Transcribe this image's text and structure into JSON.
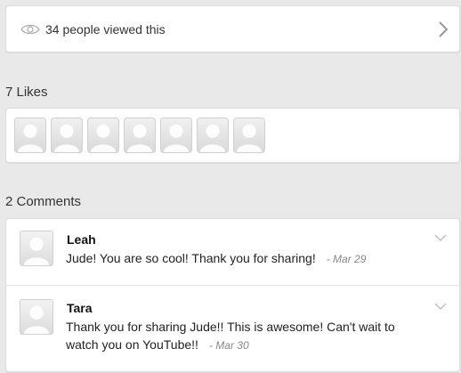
{
  "views": {
    "icon": "eye-icon",
    "text": "34 people viewed this",
    "arrow_icon": "chevron-right-icon"
  },
  "likes": {
    "title": "7 Likes",
    "count": 7,
    "avatar_icon": "default-avatar-icon"
  },
  "comments": {
    "title": "2 Comments",
    "items": [
      {
        "name": "Leah",
        "text": "Jude! You are so cool! Thank you for sharing!",
        "date": "- Mar 29"
      },
      {
        "name": "Tara",
        "text": "Thank you for sharing Jude!!  This is awesome! Can't wait to watch you on YouTube!!",
        "date": "- Mar 30"
      }
    ]
  },
  "colors": {
    "background": "#e9e9e9",
    "card": "#ffffff",
    "meta_text": "#888888"
  }
}
